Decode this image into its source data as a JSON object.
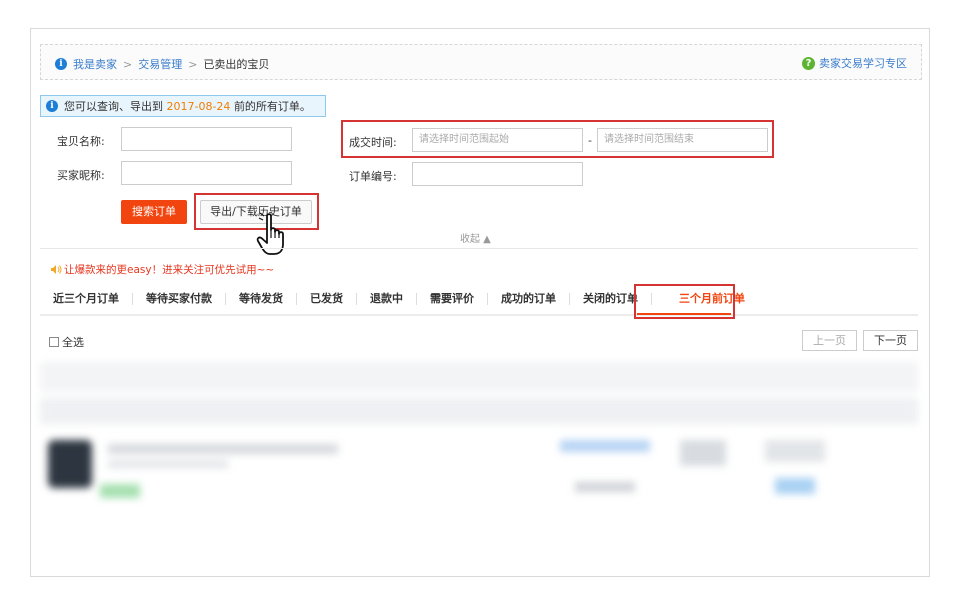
{
  "breadcrumb": {
    "items": [
      "我是卖家",
      "交易管理",
      "已卖出的宝贝"
    ],
    "separator": ">"
  },
  "help_link": "卖家交易学习专区",
  "notice": {
    "prefix": "您可以查询、导出到",
    "date": "2017-08-24",
    "suffix": "前的所有订单。"
  },
  "form": {
    "item_name_label": "宝贝名称:",
    "buyer_label": "买家昵称:",
    "deal_time_label": "成交时间:",
    "start_placeholder": "请选择时间范围起始",
    "dash": "-",
    "end_placeholder": "请选择时间范围结束",
    "order_no_label": "订单编号:",
    "search_button": "搜索订单",
    "export_button": "导出/下载历史订单",
    "collapse": "收起 ▲"
  },
  "promo": "让爆款来的更easy！进来关注可优先试用~~",
  "tabs": [
    "近三个月订单",
    "等待买家付款",
    "等待发货",
    "已发货",
    "退款中",
    "需要评价",
    "成功的订单",
    "关闭的订单",
    "三个月前订单"
  ],
  "active_tab": "三个月前订单",
  "select_all": "全选",
  "pager": {
    "prev": "上一页",
    "next": "下一页"
  },
  "colors": {
    "accent": "#f2440e",
    "link": "#3a7ccb",
    "highlight_box": "#d63333"
  }
}
